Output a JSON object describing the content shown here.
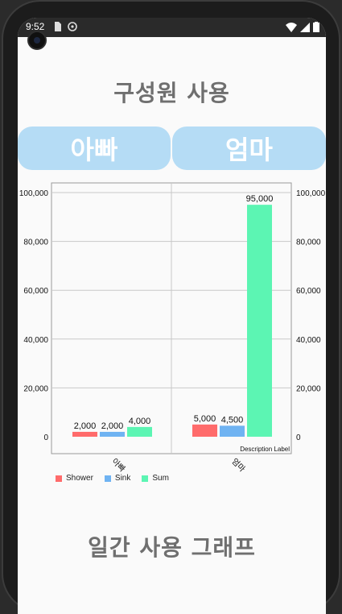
{
  "status": {
    "time": "9:52"
  },
  "header": {
    "title": "구성원 사용"
  },
  "members": [
    {
      "label": "아빠"
    },
    {
      "label": "엄마"
    }
  ],
  "chart_description": "Description Label",
  "chart_data": {
    "type": "bar",
    "categories": [
      "아빠",
      "엄마"
    ],
    "series": [
      {
        "name": "Shower",
        "color": "#ff6b6b",
        "values": [
          2000,
          5000
        ],
        "labels": [
          "2,000",
          "5,000"
        ]
      },
      {
        "name": "Sink",
        "color": "#6fb3f2",
        "values": [
          2000,
          4500
        ],
        "labels": [
          "2,000",
          "4,500"
        ]
      },
      {
        "name": "Sum",
        "color": "#5cf5b3",
        "values": [
          4000,
          95000
        ],
        "labels": [
          "4,000",
          "95,000"
        ]
      }
    ],
    "ylim": [
      0,
      100000
    ],
    "yticks": [
      0,
      20000,
      40000,
      60000,
      80000,
      100000
    ],
    "ytick_labels": [
      "0",
      "20,000",
      "40,000",
      "60,000",
      "80,000",
      "100,000"
    ],
    "grid": true,
    "legend_position": "bottom-left"
  },
  "footer": {
    "title": "일간 사용 그래프"
  }
}
